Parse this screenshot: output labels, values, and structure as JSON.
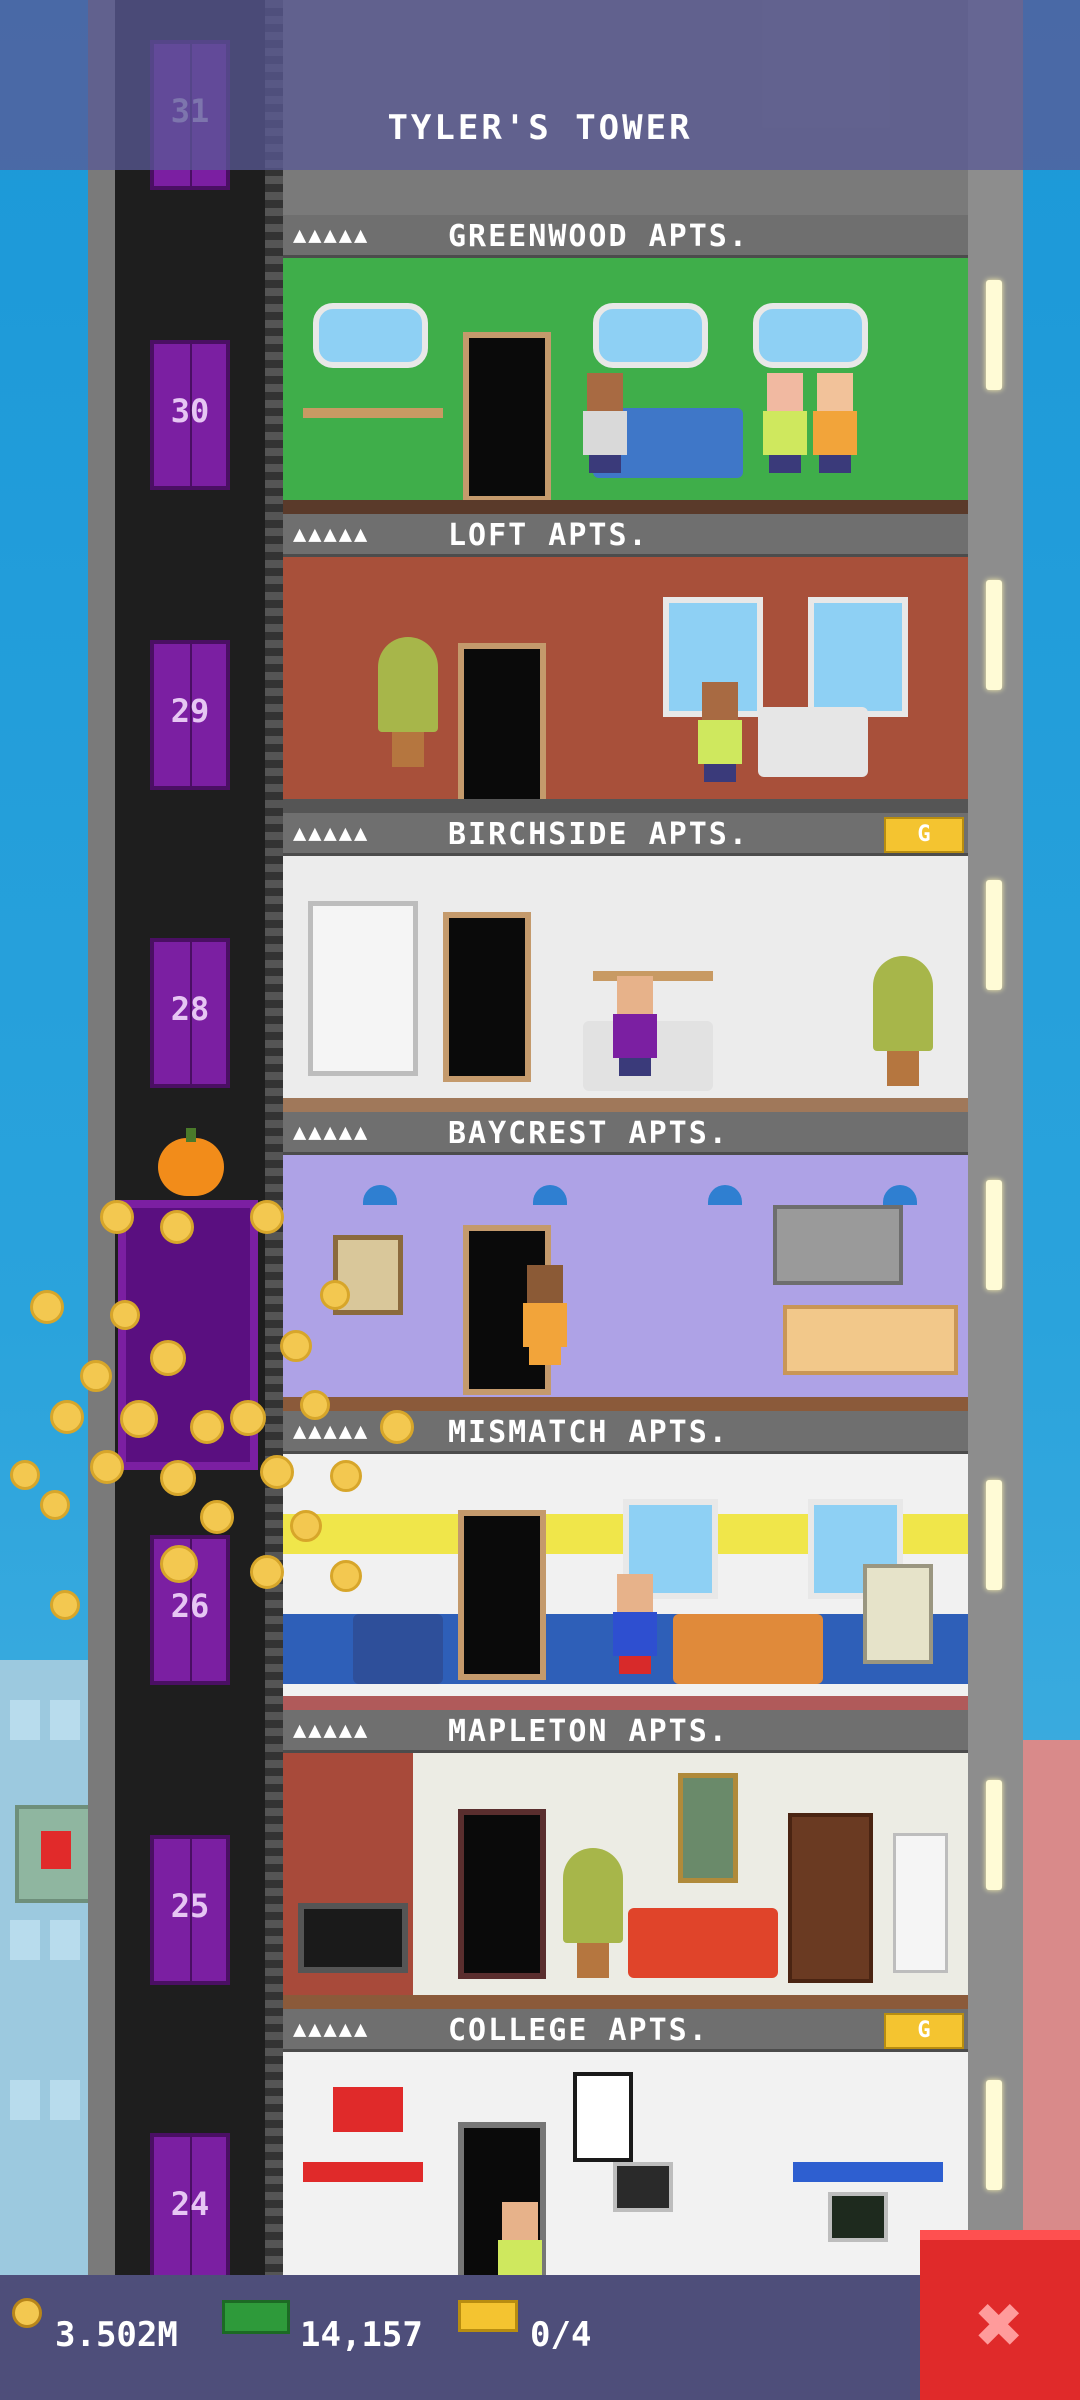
{
  "header": {
    "title": "TYLER'S TOWER"
  },
  "elevator": {
    "floor_numbers": [
      "31",
      "30",
      "29",
      "28",
      "26",
      "25",
      "24"
    ]
  },
  "floors": [
    {
      "name": "GREENWOOD APTS.",
      "stars": "▲▲▲▲▲",
      "gold_badge": ""
    },
    {
      "name": "LOFT APTS.",
      "stars": "▲▲▲▲▲",
      "gold_badge": ""
    },
    {
      "name": "BIRCHSIDE APTS.",
      "stars": "▲▲▲▲▲",
      "gold_badge": "G"
    },
    {
      "name": "BAYCREST APTS.",
      "stars": "▲▲▲▲▲",
      "gold_badge": ""
    },
    {
      "name": "MISMATCH APTS.",
      "stars": "▲▲▲▲▲",
      "gold_badge": ""
    },
    {
      "name": "MAPLETON APTS.",
      "stars": "▲▲▲▲▲",
      "gold_badge": ""
    },
    {
      "name": "COLLEGE APTS.",
      "stars": "▲▲▲▲▲",
      "gold_badge": "G"
    }
  ],
  "stats": {
    "coins": "3.502M",
    "cash": "14,157",
    "bux": "0/4"
  },
  "icons": {
    "coins": "coin-icon",
    "cash": "cash-icon",
    "bux": "bux-icon",
    "close": "close-icon"
  },
  "colors": {
    "sky": "#2aa3dc",
    "elevator": "#7b1fa2",
    "close_button": "#e02a2a",
    "bar": "#4e4e7a"
  }
}
